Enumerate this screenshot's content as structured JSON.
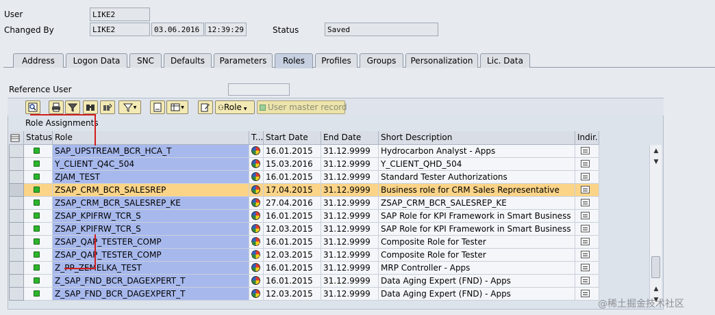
{
  "header": {
    "user_label": "User",
    "user_value": "LIKE2",
    "changed_by_label": "Changed By",
    "changed_by_value": "LIKE2",
    "changed_date": "03.06.2016",
    "changed_time": "12:39:29",
    "status_label": "Status",
    "status_value": "Saved"
  },
  "tabs": [
    {
      "label": "Address",
      "active": false
    },
    {
      "label": "Logon Data",
      "active": false
    },
    {
      "label": "SNC",
      "active": false
    },
    {
      "label": "Defaults",
      "active": false
    },
    {
      "label": "Parameters",
      "active": false
    },
    {
      "label": "Roles",
      "active": true
    },
    {
      "label": "Profiles",
      "active": false
    },
    {
      "label": "Groups",
      "active": false
    },
    {
      "label": "Personalization",
      "active": false
    },
    {
      "label": "Lic. Data",
      "active": false
    }
  ],
  "reference_user": {
    "label": "Reference User",
    "value": ""
  },
  "toolbar": {
    "role_button_label": "Role",
    "user_master_label": "User master record"
  },
  "role_assignments": {
    "title": "Role Assignments",
    "columns": {
      "status": "Status",
      "role": "Role",
      "type": "T...",
      "start_date": "Start Date",
      "end_date": "End Date",
      "short_description": "Short Description",
      "indirect": "Indir..."
    },
    "rows": [
      {
        "role": "SAP_UPSTREAM_BCR_HCA_T",
        "start": "16.01.2015",
        "end": "31.12.9999",
        "desc": "Hydrocarbon Analyst - Apps",
        "composite": false,
        "highlight": false
      },
      {
        "role": "Y_CLIENT_Q4C_504",
        "start": "15.03.2016",
        "end": "31.12.9999",
        "desc": "Y_CLIENT_QHD_504",
        "composite": false,
        "highlight": false
      },
      {
        "role": "ZJAM_TEST",
        "start": "16.01.2015",
        "end": "31.12.9999",
        "desc": "Standard Tester Authorizations",
        "composite": false,
        "highlight": false
      },
      {
        "role": "ZSAP_CRM_BCR_SALESREP",
        "start": "17.04.2015",
        "end": "31.12.9999",
        "desc": "Business role for CRM Sales Representative",
        "composite": false,
        "highlight": true
      },
      {
        "role": "ZSAP_CRM_BCR_SALESREP_KE",
        "start": "27.04.2016",
        "end": "31.12.9999",
        "desc": "ZSAP_CRM_BCR_SALESREP_KE",
        "composite": false,
        "highlight": false
      },
      {
        "role": "ZSAP_KPIFRW_TCR_S",
        "start": "16.01.2015",
        "end": "31.12.9999",
        "desc": "SAP Role for KPI Framework in Smart Business",
        "composite": false,
        "highlight": false
      },
      {
        "role": "ZSAP_KPIFRW_TCR_S",
        "start": "12.03.2015",
        "end": "31.12.9999",
        "desc": "SAP Role for KPI Framework in Smart Business",
        "composite": false,
        "highlight": false
      },
      {
        "role": "ZSAP_QAP_TESTER_COMP",
        "start": "16.01.2015",
        "end": "31.12.9999",
        "desc": "Composite Role for Tester",
        "composite": true,
        "highlight": false
      },
      {
        "role": "ZSAP_QAP_TESTER_COMP",
        "start": "12.03.2015",
        "end": "31.12.9999",
        "desc": "Composite Role for Tester",
        "composite": true,
        "highlight": false
      },
      {
        "role": "Z_PP_ZEMELKA_TEST",
        "start": "16.01.2015",
        "end": "31.12.9999",
        "desc": "MRP Controller - Apps",
        "composite": false,
        "highlight": false
      },
      {
        "role": "Z_SAP_FND_BCR_DAGEXPERT_T",
        "start": "16.01.2015",
        "end": "31.12.9999",
        "desc": "Data Aging Expert (FND) - Apps",
        "composite": false,
        "highlight": false
      },
      {
        "role": "Z_SAP_FND_BCR_DAGEXPERT_T",
        "start": "12.03.2015",
        "end": "31.12.9999",
        "desc": "Data Aging Expert (FND) - Apps",
        "composite": false,
        "highlight": false
      }
    ]
  },
  "watermark": "@稀土掘金技术社区",
  "colors": {
    "role_cell": "#a7b8ec",
    "highlight_row": "#fbd488",
    "status_led": "#2bb52b",
    "annotation_red": "#d21c1c"
  }
}
